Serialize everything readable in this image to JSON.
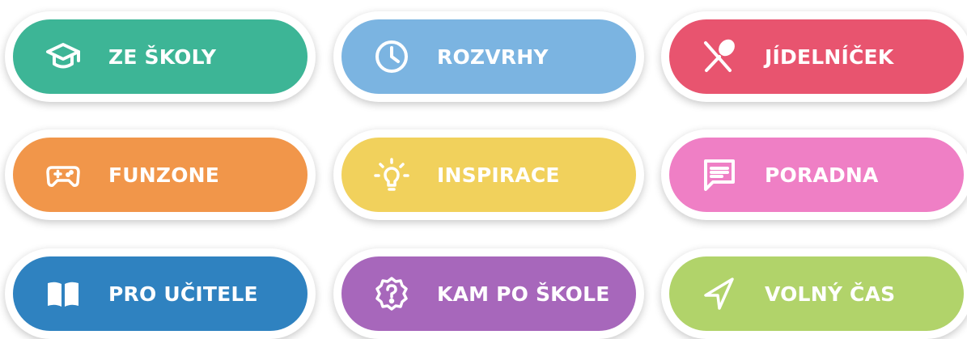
{
  "tiles": [
    {
      "label": "ZE ŠKOLY",
      "color": "#3db596",
      "icon": "graduation-cap-icon"
    },
    {
      "label": "ROZVRHY",
      "color": "#7bb4e1",
      "icon": "clock-icon"
    },
    {
      "label": "JÍDELNÍČEK",
      "color": "#e8546f",
      "icon": "fork-spoon-icon"
    },
    {
      "label": "FUNZONE",
      "color": "#f1964a",
      "icon": "gamepad-icon"
    },
    {
      "label": "INSPIRACE",
      "color": "#f1d15c",
      "icon": "lightbulb-icon"
    },
    {
      "label": "PORADNA",
      "color": "#ef7fc5",
      "icon": "chat-bubble-icon"
    },
    {
      "label": "PRO UČITELE",
      "color": "#2f82c0",
      "icon": "open-book-icon"
    },
    {
      "label": "KAM PO ŠKOLE",
      "color": "#a767bb",
      "icon": "question-badge-icon"
    },
    {
      "label": "VOLNÝ ČAS",
      "color": "#b1d36a",
      "icon": "paper-plane-icon"
    }
  ]
}
